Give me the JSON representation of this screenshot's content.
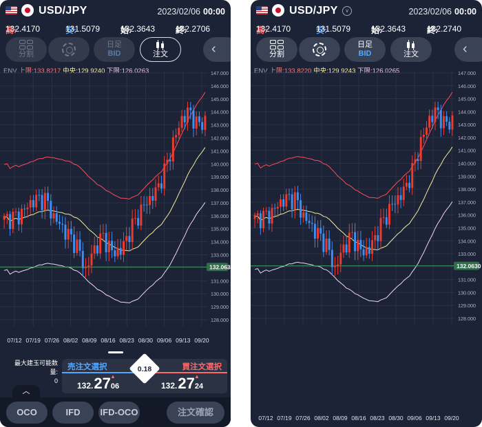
{
  "left": {
    "pair": "USD/JPY",
    "date": "2023/02/06",
    "time": "00:00",
    "ohlc": {
      "high_label": "高:",
      "high": "132.4170",
      "low_label": "安:",
      "low": "131.5079",
      "open_label": "始:",
      "open": "132.3643",
      "close_label": "終:",
      "close": "132.2706"
    },
    "toolbar": {
      "split": "分割",
      "ashi": "日足",
      "ashi_sub": "BID",
      "order": "注文"
    },
    "env": {
      "name": "ENV",
      "upper_label": "上限:",
      "upper": "133.8217",
      "mid_label": "中央:",
      "mid": "129.9240",
      "lower_label": "下限:",
      "lower": "126.0263"
    },
    "price_tag": "132.0630",
    "max_lot_label": "最大建玉可能数量:",
    "max_lot": "0",
    "sell_label": "売注文選択",
    "buy_label": "買注文選択",
    "sell_price": {
      "head": "132.",
      "big": "27",
      "tail": "06"
    },
    "buy_price": {
      "head": "132.",
      "big": "27",
      "tail": "24"
    },
    "spread": "0.18",
    "buttons": {
      "oco": "OCO",
      "ifd": "IFD",
      "ifdoco": "IFD-OCO",
      "confirm": "注文確認"
    }
  },
  "right": {
    "pair": "USD/JPY",
    "date": "2023/02/06",
    "time": "00:00",
    "ohlc": {
      "high_label": "高:",
      "high": "132.4170",
      "low_label": "安:",
      "low": "131.5079",
      "open_label": "始:",
      "open": "132.3643",
      "close_label": "終:",
      "close": "132.2740"
    },
    "toolbar": {
      "split": "分割",
      "ashi": "日足",
      "ashi_sub": "BID",
      "order": "注文"
    },
    "env": {
      "name": "ENV",
      "upper_label": "上限:",
      "upper": "133.8220",
      "mid_label": "中央:",
      "mid": "129.9243",
      "lower_label": "下限:",
      "lower": "126.0265"
    },
    "price_tag": "132.0630"
  },
  "chart_data": {
    "type": "candlestick",
    "x_labels": [
      "07/12",
      "07/19",
      "07/26",
      "08/02",
      "08/09",
      "08/16",
      "08/23",
      "08/30",
      "09/06",
      "09/13",
      "09/20"
    ],
    "y_ticks": [
      147,
      146,
      145,
      144,
      143,
      142,
      141,
      140,
      139,
      138,
      137,
      136,
      135,
      134,
      133,
      132,
      131,
      130,
      129,
      128
    ],
    "price_line": 132.063,
    "colors": {
      "up": "#ef3b2d",
      "down": "#3e8ef7",
      "upper_band": "#ff4b5c",
      "mid_band": "#f4ee9a",
      "lower_band": "#f1d6f1",
      "price_line": "#3f9a59",
      "price_tag_bg": "#2f6e48"
    }
  }
}
